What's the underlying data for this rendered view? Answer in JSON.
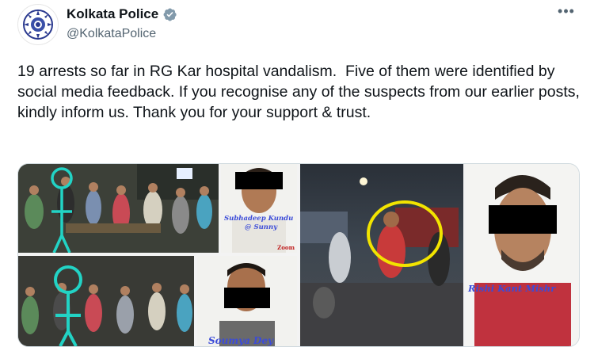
{
  "account": {
    "display_name": "Kolkata Police",
    "handle": "@KolkataPolice",
    "verified_color": "#829aab",
    "avatar_icon": "kolkata-police-emblem-icon"
  },
  "menu": {
    "more_icon": "more-options-icon",
    "label": "•••"
  },
  "tweet": {
    "text": "19 arrests so far in RG Kar hospital vandalism.  Five of them were identified by social media feedback. If you recognise any of the suspects from our earlier posts, kindly inform us. Thank you for your support & trust."
  },
  "media": {
    "captions": {
      "suspect_1": "Subhadeep Kundu",
      "suspect_1_alias": "@ Sunny",
      "suspect_2": "Soumya Dey",
      "suspect_3": "Rishi Kant Mishr"
    },
    "watermark": "Zoom",
    "colors": {
      "highlight_cyan": "#22d3c5",
      "highlight_yellow": "#f2e400",
      "caption_blue": "#3b4bd8"
    }
  }
}
